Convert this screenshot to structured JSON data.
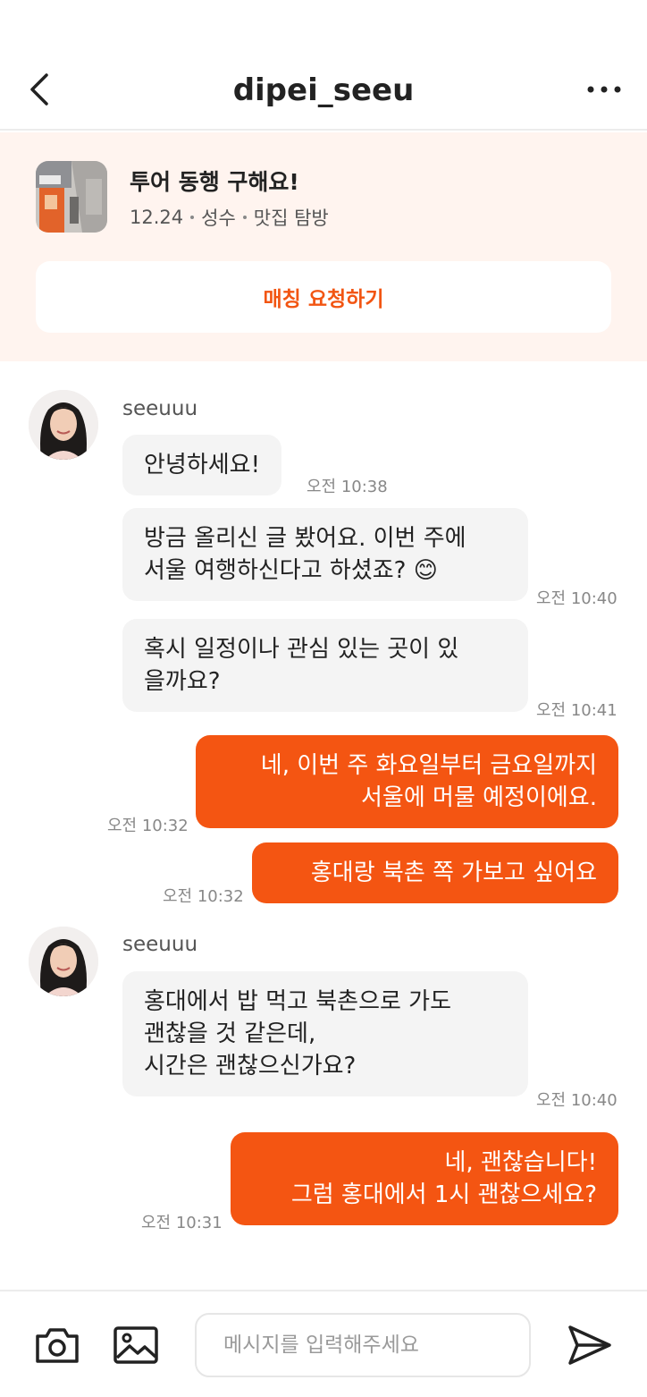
{
  "header": {
    "title": "dipei_seeu",
    "back_icon": "chevron-left-icon",
    "more_icon": "more-horizontal-icon"
  },
  "post": {
    "title": "투어 동행 구해요!",
    "meta": [
      "12.24",
      "성수",
      "맛집 탐방"
    ],
    "match_button_label": "매칭 요청하기"
  },
  "chat": {
    "group1_sender": "seeuuu",
    "group2_sender": "seeuuu",
    "messages": [
      {
        "from": "them",
        "text": "안녕하세요!",
        "time": "오전 10:38"
      },
      {
        "from": "them",
        "text": "방금 올리신 글 봤어요. 이번 주에\n서울 여행하신다고 하셨죠? 😊",
        "time": "오전 10:40"
      },
      {
        "from": "them",
        "text": "혹시 일정이나 관심 있는 곳이 있\n을까요?",
        "time": "오전 10:41"
      },
      {
        "from": "me",
        "text": "네, 이번 주 화요일부터 금요일까지\n서울에 머물 예정이에요.",
        "time": "오전 10:32"
      },
      {
        "from": "me",
        "text": "홍대랑 북촌 쪽 가보고 싶어요",
        "time": "오전 10:32"
      },
      {
        "from": "them",
        "text": "홍대에서 밥 먹고 북촌으로 가도\n괜찮을 것 같은데,\n시간은 괜찮으신가요?",
        "time": "오전 10:40"
      },
      {
        "from": "me",
        "text": "네, 괜찮습니다!\n그럼 홍대에서 1시 괜찮으세요?",
        "time": "오전 10:31"
      }
    ]
  },
  "input": {
    "placeholder": "메시지를 입력해주세요",
    "value": ""
  },
  "colors": {
    "accent": "#f45512",
    "post_bg": "#fff4ef",
    "bubble_in": "#f4f4f4"
  }
}
